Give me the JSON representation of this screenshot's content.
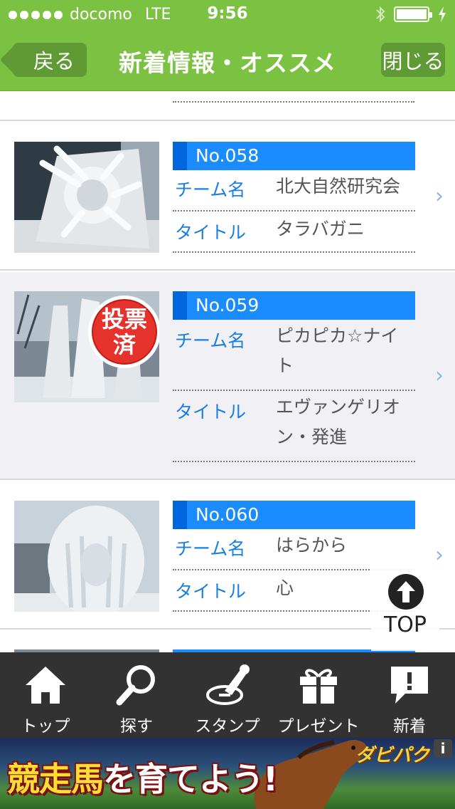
{
  "status": {
    "carrier": "docomo",
    "network": "LTE",
    "time": "9:56"
  },
  "nav": {
    "back_label": "戻る",
    "title": "新着情報・オススメ",
    "close_label": "閉じる"
  },
  "entries": [
    {
      "no": "No.058",
      "team_key": "チーム名",
      "team": "北大自然研究会",
      "title_key": "タイトル",
      "title": "タラバガニ",
      "voted": false
    },
    {
      "no": "No.059",
      "team_key": "チーム名",
      "team": "ピカピカ☆ナイト",
      "title_key": "タイトル",
      "title": "エヴァンゲリオン・発進",
      "voted": true,
      "badge": "投票済"
    },
    {
      "no": "No.060",
      "team_key": "チーム名",
      "team": "はらから",
      "title_key": "タイトル",
      "title": "心",
      "voted": false
    }
  ],
  "top_button": {
    "label": "TOP"
  },
  "tabs": [
    {
      "label": "トップ",
      "icon": "home-icon"
    },
    {
      "label": "探す",
      "icon": "search-icon"
    },
    {
      "label": "スタンプ",
      "icon": "stamp-icon"
    },
    {
      "label": "プレゼント",
      "icon": "gift-icon"
    },
    {
      "label": "新着",
      "icon": "news-bubble-icon"
    }
  ],
  "ad": {
    "headline_1": "競走馬",
    "headline_2": "を育てよう!",
    "logo": "ダビパク"
  },
  "colors": {
    "accent": "#7cc242",
    "number_bar": "#1a8cff",
    "key_text": "#1a7fe0",
    "tabbar": "#323232"
  }
}
